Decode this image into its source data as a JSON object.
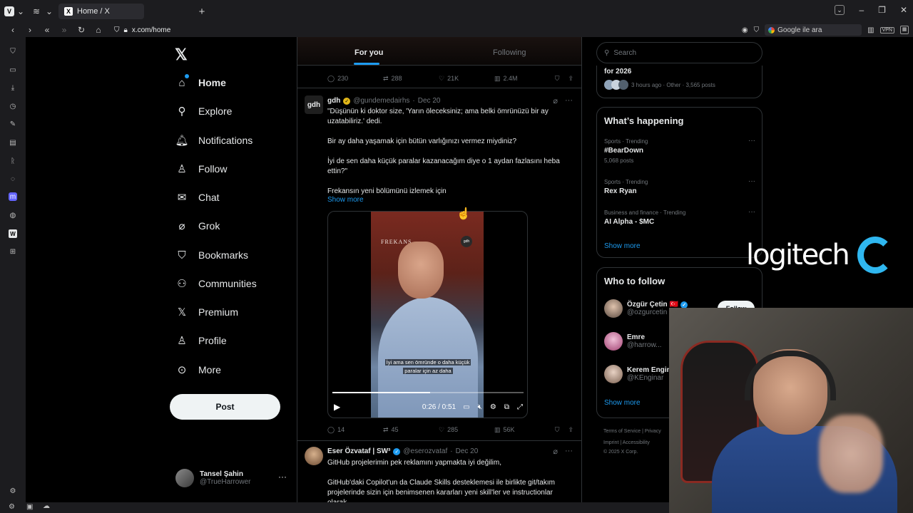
{
  "browser": {
    "tab_title": "Home / X",
    "url": "x.com/home",
    "search_placeholder": "Google ile ara",
    "vpn_label": "VPN"
  },
  "nav": {
    "items": [
      {
        "label": "Home",
        "icon": "home-icon"
      },
      {
        "label": "Explore",
        "icon": "search-icon"
      },
      {
        "label": "Notifications",
        "icon": "bell-icon"
      },
      {
        "label": "Follow",
        "icon": "person-add-icon"
      },
      {
        "label": "Chat",
        "icon": "mail-icon"
      },
      {
        "label": "Grok",
        "icon": "grok-icon"
      },
      {
        "label": "Bookmarks",
        "icon": "bookmark-icon"
      },
      {
        "label": "Communities",
        "icon": "communities-icon"
      },
      {
        "label": "Premium",
        "icon": "x-icon"
      },
      {
        "label": "Profile",
        "icon": "person-icon"
      },
      {
        "label": "More",
        "icon": "more-circle-icon"
      }
    ],
    "post_label": "Post",
    "account": {
      "name": "Tansel Şahin",
      "handle": "@TrueHarrower"
    }
  },
  "timeline": {
    "tabs": {
      "for_you": "For you",
      "following": "Following"
    },
    "prev_actions": {
      "replies": "230",
      "reposts": "288",
      "likes": "21K",
      "views": "2.4M"
    },
    "tweet1": {
      "name": "gdh",
      "handle": "@gundemedairhs",
      "date": "Dec 20",
      "avatar_text": "gdh",
      "lines": [
        "\"Düşünün ki doktor size, 'Yarın öleceksiniz; ama belki ömrünüzü bir ay uzatabiliriz.' dedi.",
        "Bir ay daha yaşamak için bütün varlığınızı vermez miydiniz?",
        "İyi de sen daha küçük paralar kazanacağım diye o 1 aydan fazlasını heba ettin?\"",
        "Frekansın yeni bölümünü izlemek için"
      ],
      "show_more": "Show more",
      "video": {
        "brand": "FREKANS",
        "badge": "gdh",
        "subtitle_1": "İyi ama sen ömründe o daha küçük",
        "subtitle_2": "paralar için az daha",
        "time": "0:26 / 0:51",
        "progress": 0.51
      },
      "actions": {
        "replies": "14",
        "reposts": "45",
        "likes": "285",
        "views": "56K"
      }
    },
    "tweet2": {
      "name": "Eser Özvataf | SW³",
      "handle": "@eserozvataf",
      "date": "Dec 20",
      "lines": [
        "GitHub projelerimin pek reklamını yapmakta iyi değilim,",
        "GitHub'daki Copilot'un da Claude Skills desteklemesi ile birlikte git/takım projelerinde sizin için benimsenen kararları yeni skill'ler ve instructionlar olarak"
      ]
    }
  },
  "right": {
    "search_placeholder": "Search",
    "top_trend": {
      "title": "for 2026",
      "meta": "3 hours ago · Other · 3,565 posts"
    },
    "happening_title": "What’s happening",
    "trends": [
      {
        "meta": "Sports · Trending",
        "name": "#BearDown",
        "posts": "5,068 posts"
      },
      {
        "meta": "Sports · Trending",
        "name": "Rex Ryan",
        "posts": ""
      },
      {
        "meta": "Business and finance · Trending",
        "name": "AI Alpha - $MC",
        "posts": ""
      }
    ],
    "show_more": "Show more",
    "wtf_title": "Who to follow",
    "who_to_follow": [
      {
        "name": "Özgür Çetin",
        "handle": "@ozgurcetin",
        "flag": "🇹🇷"
      },
      {
        "name": "Emre",
        "handle": "@harrow...",
        "flag": ""
      },
      {
        "name": "Kerem Engin",
        "handle": "@KEnginar",
        "flag": ""
      }
    ],
    "follow_label": "Follow",
    "footer": {
      "terms": "Terms of Service",
      "privacy": "Privacy",
      "imprint": "Imprint",
      "accessibility": "Accessibility",
      "copyright": "© 2025 X Corp."
    }
  },
  "overlay": {
    "brand": "logitech",
    "accent": "#2fb7f0"
  },
  "colors": {
    "accent": "#1d9bf0",
    "background": "#000000",
    "text": "#e7e9ea",
    "muted": "#71767b"
  }
}
